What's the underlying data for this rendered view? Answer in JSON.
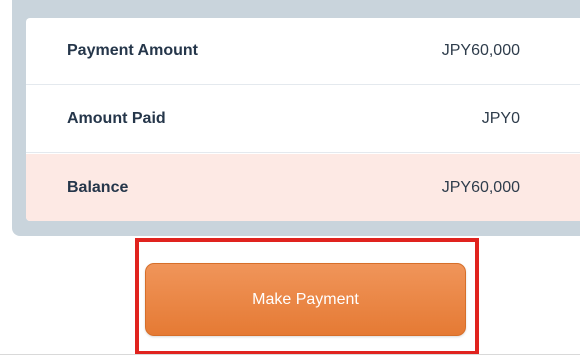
{
  "summary": {
    "rows": [
      {
        "label": "Payment Amount",
        "value": "JPY60,000"
      },
      {
        "label": "Amount Paid",
        "value": "JPY0"
      },
      {
        "label": "Balance",
        "value": "JPY60,000"
      }
    ]
  },
  "actions": {
    "make_payment_label": "Make Payment"
  },
  "colors": {
    "button": "#e8803c",
    "balance_row": "#fde9e4",
    "highlight": "#e0231e",
    "frame": "#c9d4dc"
  }
}
